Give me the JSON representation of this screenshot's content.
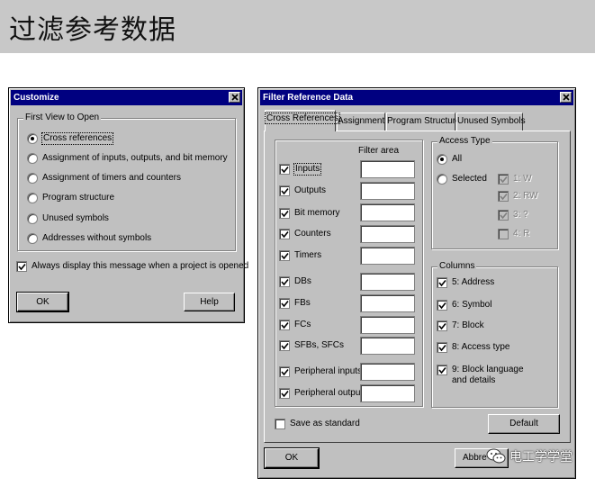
{
  "banner": {
    "title": "过滤参考数据"
  },
  "customize": {
    "title": "Customize",
    "group_label": "First View to Open",
    "options": [
      "Cross references",
      "Assignment of inputs, outputs, and bit memory",
      "Assignment of timers and counters",
      "Program structure",
      "Unused symbols",
      "Addresses without symbols"
    ],
    "selected_index": 0,
    "always_display_label": "Always display this message when a project is opened",
    "ok_label": "OK",
    "help_label": "Help"
  },
  "filter": {
    "title": "Filter Reference Data",
    "tabs": [
      "Cross References",
      "Assignment",
      "Program Structure",
      "Unused Symbols"
    ],
    "filter_area_label": "Filter area",
    "items": [
      "Inputs",
      "Outputs",
      "Bit memory",
      "Counters",
      "Timers",
      "DBs",
      "FBs",
      "FCs",
      "SFBs, SFCs",
      "Peripheral inputs",
      "Peripheral outputs"
    ],
    "access_type": {
      "label": "Access Type",
      "all_label": "All",
      "selected_label": "Selected",
      "sub_options": [
        "1: W",
        "2: RW",
        "3: ?",
        "4: R"
      ]
    },
    "columns": {
      "label": "Columns",
      "items": [
        "5: Address",
        "6: Symbol",
        "7: Block",
        "8: Access type",
        "9: Block language and details"
      ]
    },
    "save_as_standard_label": "Save as standard",
    "default_label": "Default",
    "ok_label": "OK",
    "abbrev_label": "Abbre"
  },
  "watermark": {
    "text": "电工学学堂"
  },
  "colors": {
    "titlebar": "#000080",
    "face": "#c0c0c0",
    "banner": "#c8c8c8"
  }
}
